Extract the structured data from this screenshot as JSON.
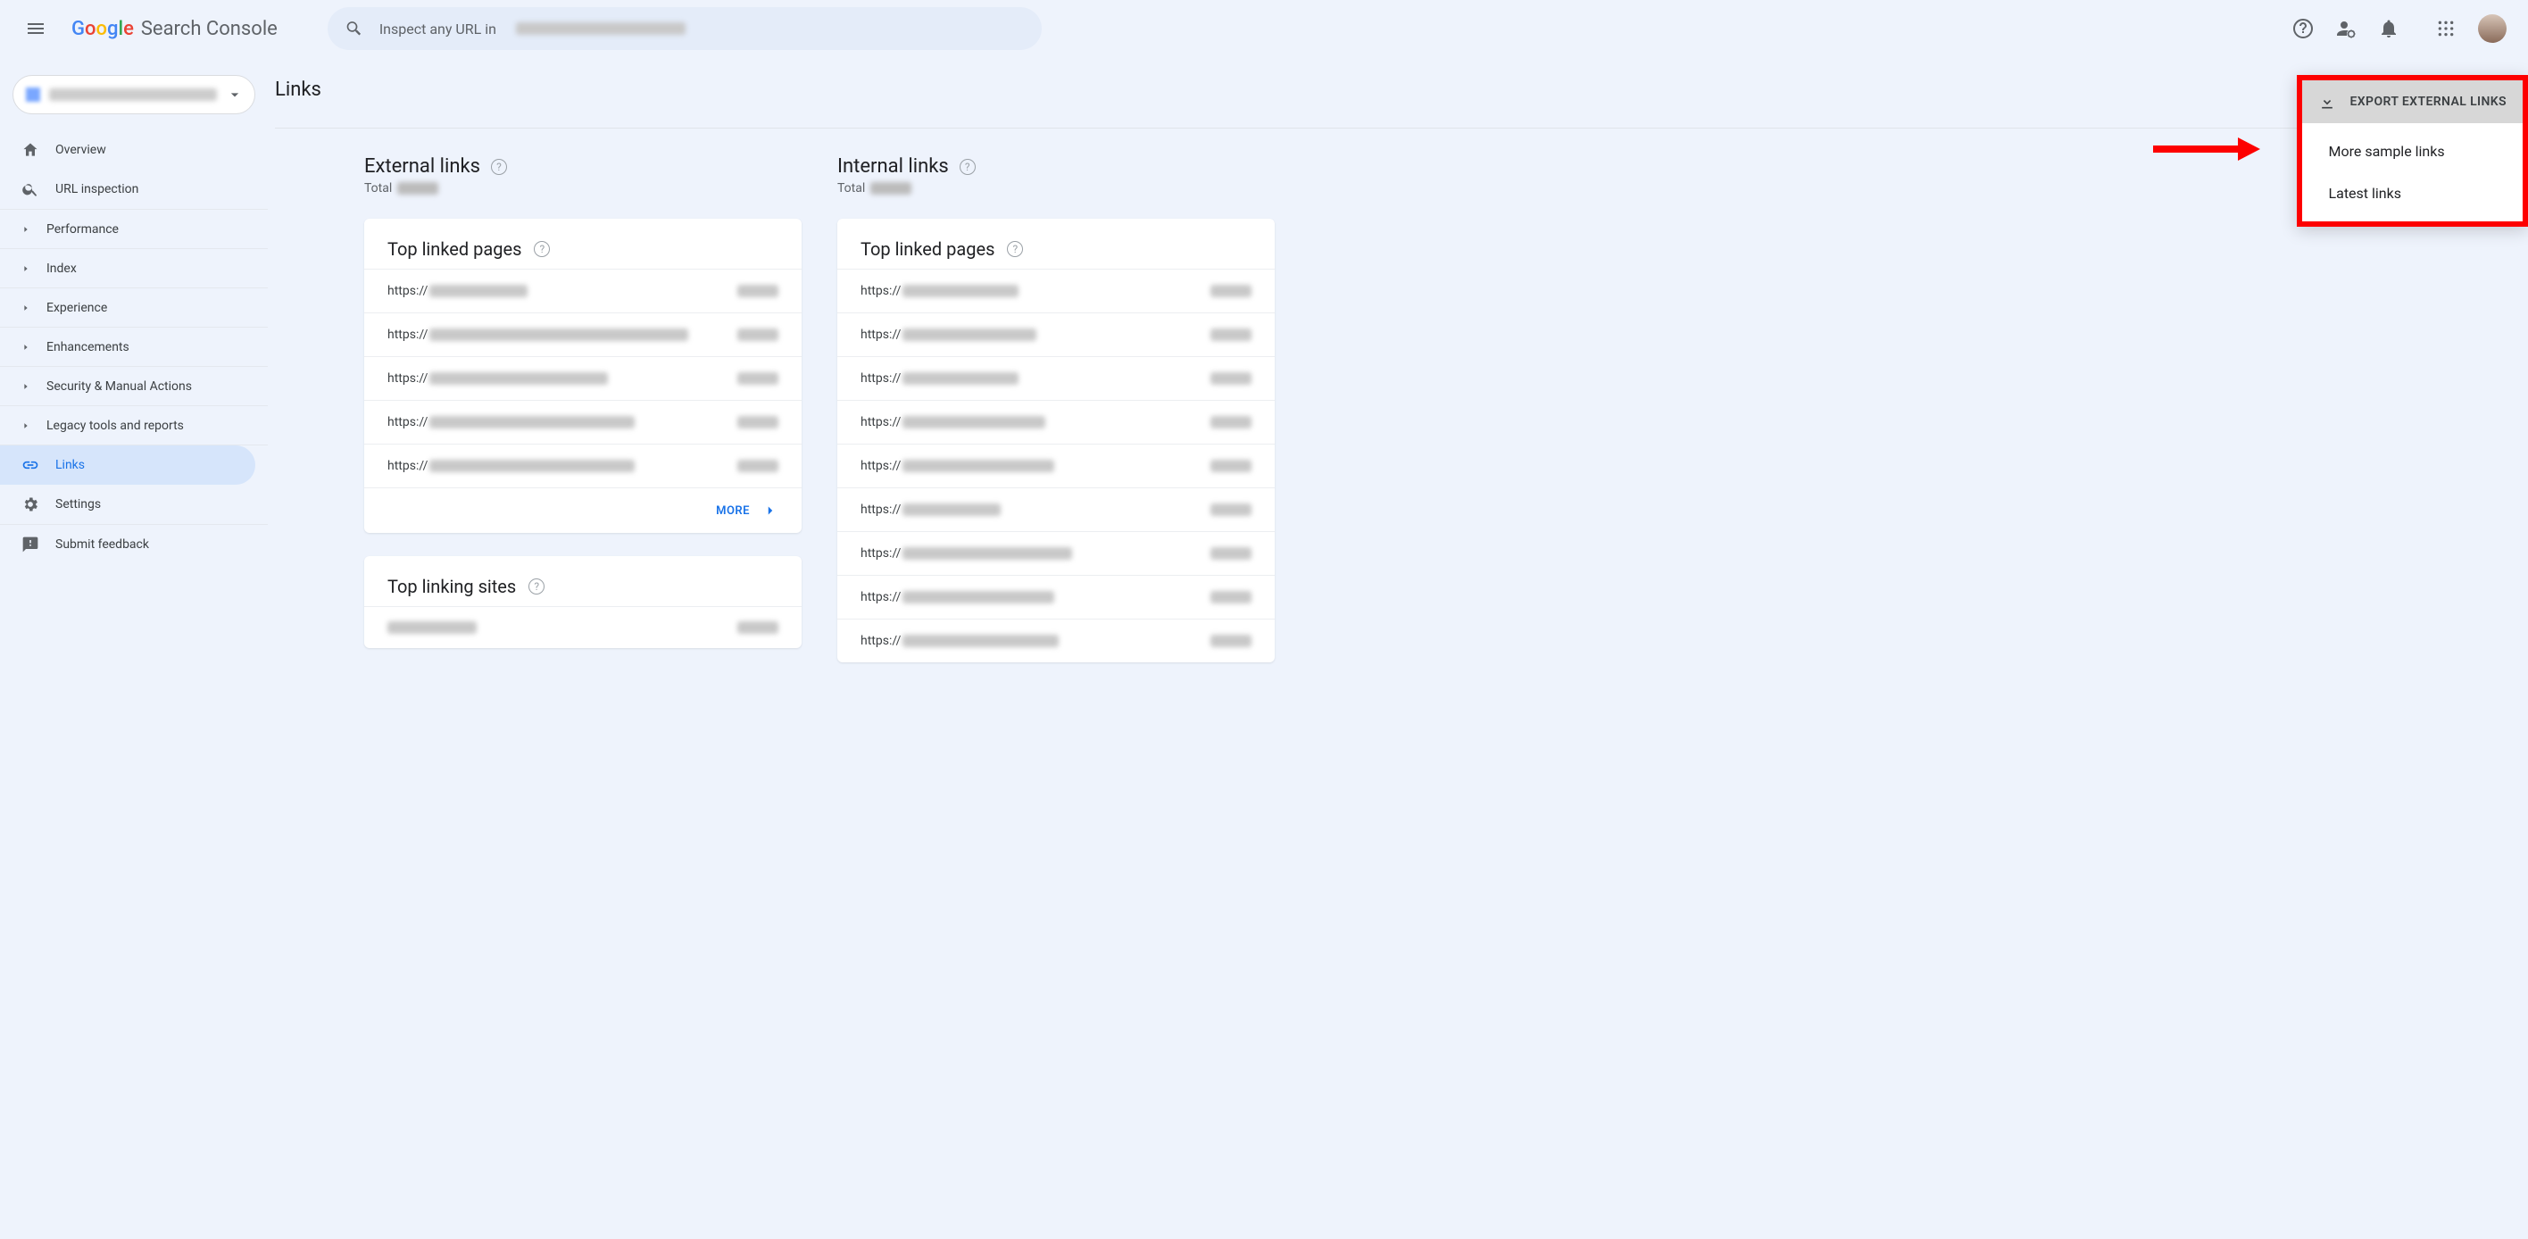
{
  "header": {
    "productName": "Search Console",
    "searchPlaceholder": "Inspect any URL in"
  },
  "sidebar": {
    "overview": "Overview",
    "urlInspection": "URL inspection",
    "groups": {
      "performance": "Performance",
      "index": "Index",
      "experience": "Experience",
      "enhancements": "Enhancements",
      "security": "Security & Manual Actions",
      "legacy": "Legacy tools and reports"
    },
    "links": "Links",
    "settings": "Settings",
    "feedback": "Submit feedback"
  },
  "page": {
    "title": "Links",
    "exportButton": "EXPORT EXTERNAL LINKS",
    "exportMenu": {
      "moreSample": "More sample links",
      "latest": "Latest links"
    }
  },
  "external": {
    "heading": "External links",
    "totalLabel": "Total",
    "card1Title": "Top linked pages",
    "card2Title": "Top linking sites",
    "more": "MORE",
    "prefix": "https://"
  },
  "internal": {
    "heading": "Internal links",
    "totalLabel": "Total",
    "card1Title": "Top linked pages",
    "prefix": "https://"
  }
}
